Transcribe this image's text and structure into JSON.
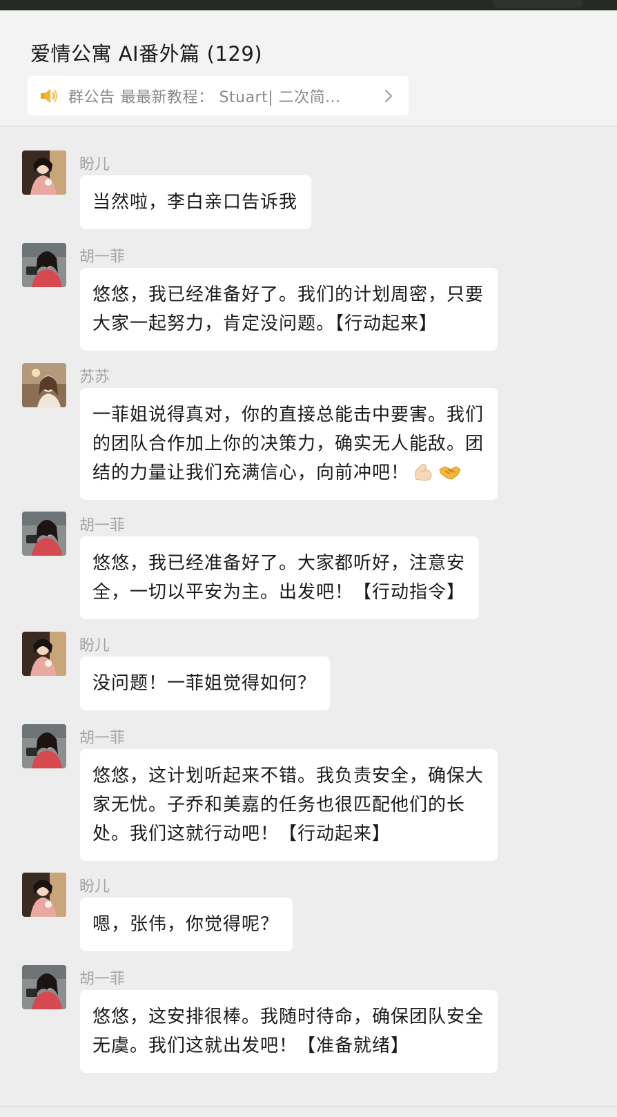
{
  "group": {
    "title": "爱情公寓 AI番外篇",
    "member_count": "(129)"
  },
  "notice": {
    "label": "群公告",
    "text": "最最新教程：",
    "preview": "Stuart| 二次简...",
    "icon": "speaker-icon",
    "chevron": "chevron-right-icon"
  },
  "colors": {
    "background": "#ededed",
    "bubble": "#ffffff",
    "sender": "#a3a3a3",
    "speaker": "#f5b52e"
  },
  "messages": [
    {
      "sender": "盼儿",
      "lines": [
        "当然啦，李白亲口告诉我"
      ]
    },
    {
      "sender": "胡一菲",
      "lines": [
        "悠悠，我已经准备好了。我们的计划周密，只要",
        "大家一起努力，肯定没问题。【行动起来】"
      ]
    },
    {
      "sender": "苏苏",
      "lines": [
        "一菲姐说得真对，你的直接总能击中要害。我们",
        "的团队合作加上你的决策力，确实无人能敌。团",
        "结的力量让我们充满信心，向前冲吧！"
      ],
      "emojis": [
        "flexed-biceps-emoji",
        "handshake-emoji"
      ]
    },
    {
      "sender": "胡一菲",
      "lines": [
        "悠悠，我已经准备好了。大家都听好，注意安",
        "全，一切以平安为主。出发吧！【行动指令】"
      ]
    },
    {
      "sender": "盼儿",
      "lines": [
        "没问题！一菲姐觉得如何？"
      ]
    },
    {
      "sender": "胡一菲",
      "lines": [
        "悠悠，这计划听起来不错。我负责安全，确保大",
        "家无忧。子乔和美嘉的任务也很匹配他们的长",
        "处。我们这就行动吧！【行动起来】"
      ]
    },
    {
      "sender": "盼儿",
      "lines": [
        "嗯，张伟，你觉得呢？"
      ]
    },
    {
      "sender": "胡一菲",
      "lines": [
        "悠悠，这安排很棒。我随时待命，确保团队安全",
        "无虞。我们这就出发吧！【准备就绪】"
      ]
    }
  ]
}
